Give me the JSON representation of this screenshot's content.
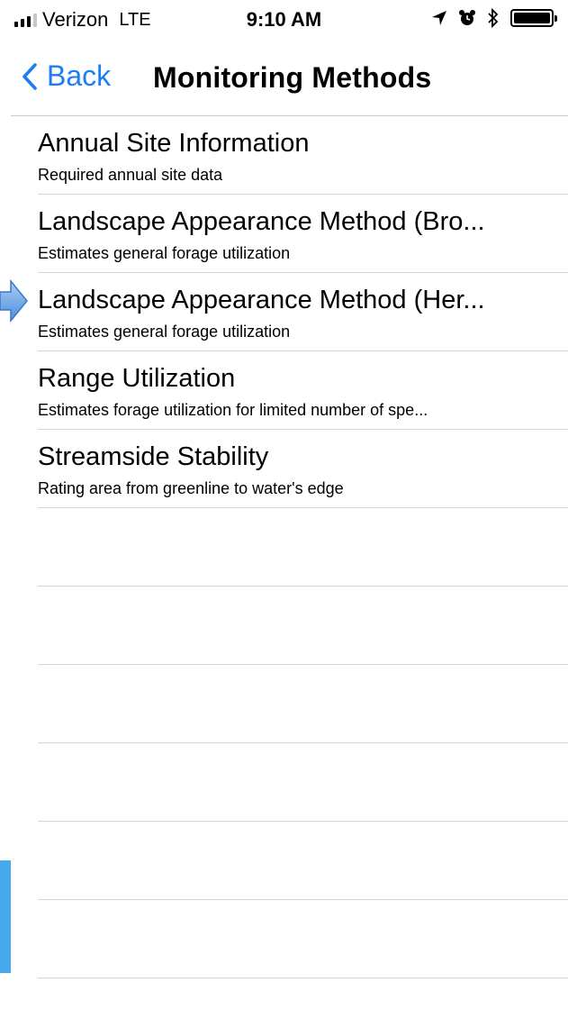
{
  "status_bar": {
    "carrier": "Verizon",
    "network": "LTE",
    "time": "9:10 AM"
  },
  "nav": {
    "back_label": "Back",
    "title": "Monitoring Methods"
  },
  "items": [
    {
      "title": "Annual Site Information",
      "subtitle": "Required annual site data"
    },
    {
      "title": "Landscape Appearance Method (Bro...",
      "subtitle": "Estimates general forage utilization"
    },
    {
      "title": "Landscape Appearance Method (Her...",
      "subtitle": "Estimates general forage utilization"
    },
    {
      "title": "Range Utilization",
      "subtitle": "Estimates forage utilization for limited number of spe..."
    },
    {
      "title": "Streamside Stability",
      "subtitle": "Rating area from greenline to water's edge"
    }
  ],
  "empty_rows": 6,
  "colors": {
    "accent": "#1b7ef2",
    "pointer": "#6fa8e8",
    "side_bar": "#46a9ee"
  }
}
